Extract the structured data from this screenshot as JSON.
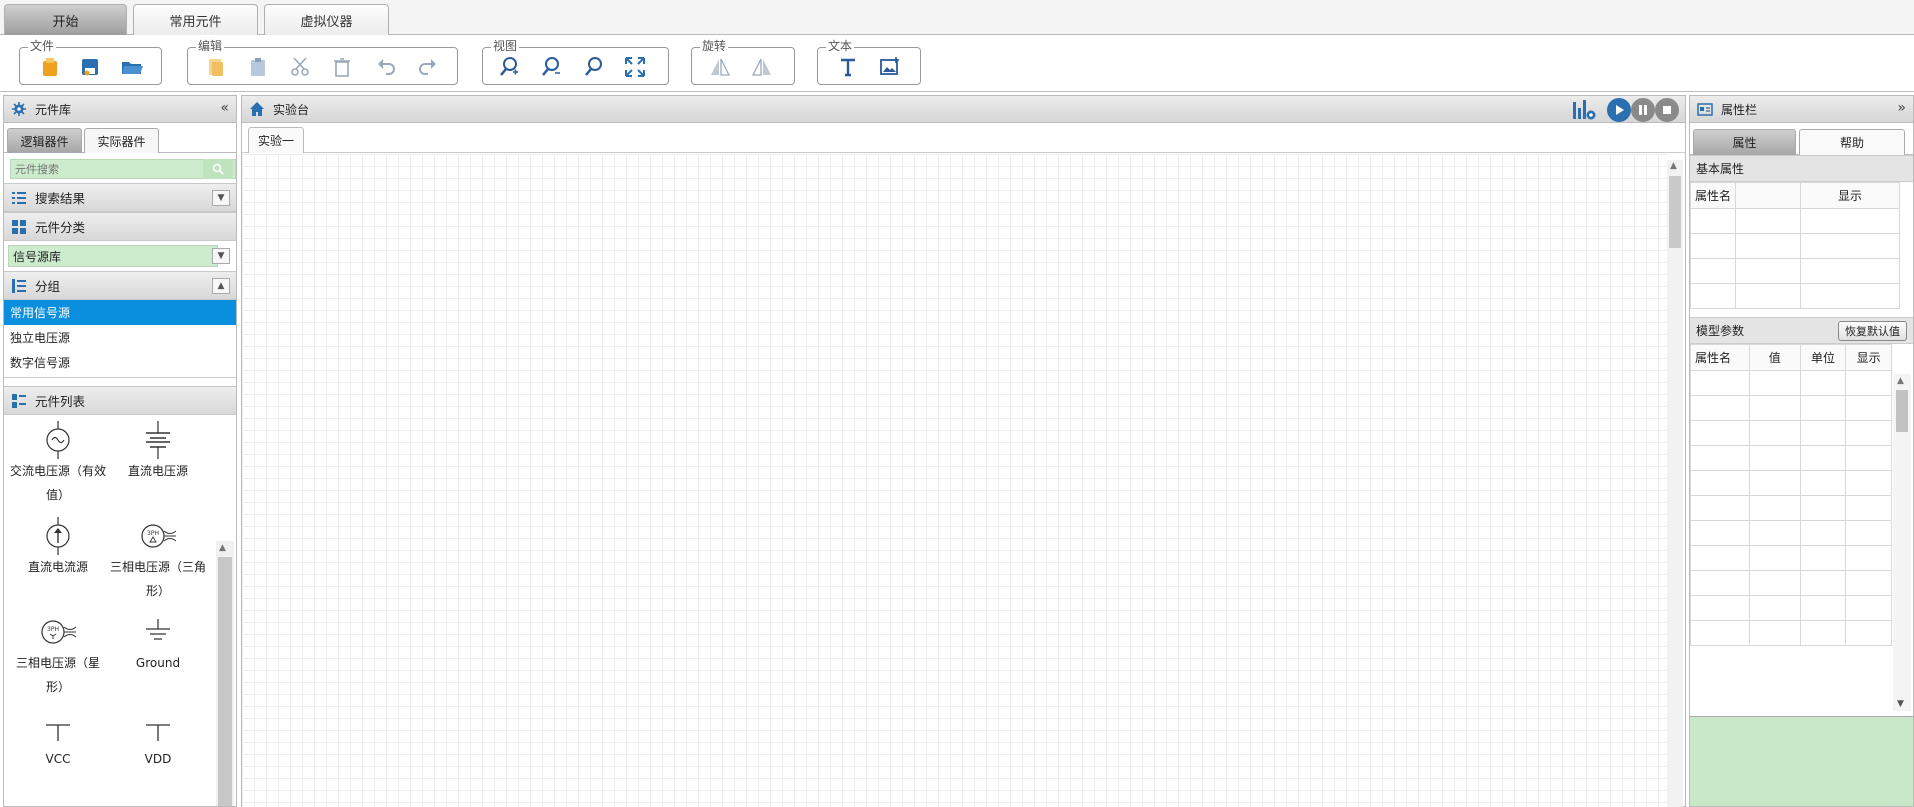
{
  "top_tabs": [
    {
      "label": "开始",
      "active": true
    },
    {
      "label": "常用元件",
      "active": false
    },
    {
      "label": "虚拟仪器",
      "active": false
    }
  ],
  "ribbon": {
    "groups": [
      {
        "label": "文件",
        "buttons": [
          "new-file-icon",
          "save-icon",
          "open-folder-icon"
        ]
      },
      {
        "label": "编辑",
        "buttons": [
          "copy-icon",
          "paste-icon",
          "cut-icon",
          "delete-icon",
          "undo-icon",
          "redo-icon"
        ]
      },
      {
        "label": "视图",
        "buttons": [
          "zoom-in-icon",
          "zoom-out-icon",
          "zoom-fit-icon",
          "fullscreen-icon"
        ]
      },
      {
        "label": "旋转",
        "buttons": [
          "flip-horizontal-icon",
          "flip-vertical-icon"
        ]
      },
      {
        "label": "文本",
        "buttons": [
          "text-icon",
          "image-icon"
        ]
      }
    ]
  },
  "left_panel": {
    "title": "元件库",
    "collapse_glyph": "«",
    "tabs": [
      {
        "label": "逻辑器件",
        "active": true
      },
      {
        "label": "实际器件",
        "active": false
      }
    ],
    "search_placeholder": "元件搜索",
    "search_results_label": "搜索结果",
    "category_label": "元件分类",
    "category_value": "信号源库",
    "group_label": "分组",
    "groups": [
      {
        "label": "常用信号源",
        "selected": true
      },
      {
        "label": "独立电压源",
        "selected": false
      },
      {
        "label": "数字信号源",
        "selected": false
      }
    ],
    "parts_label": "元件列表",
    "parts": [
      {
        "label": "交流电压源（有效值）",
        "icon": "ac-source-icon"
      },
      {
        "label": "直流电压源",
        "icon": "dc-voltage-icon"
      },
      {
        "label": "直流电流源",
        "icon": "dc-current-icon"
      },
      {
        "label": "三相电压源（三角形）",
        "icon": "three-phase-delta-icon"
      },
      {
        "label": "三相电压源（星形）",
        "icon": "three-phase-star-icon"
      },
      {
        "label": "Ground",
        "icon": "ground-icon"
      },
      {
        "label": "VCC",
        "icon": "vcc-icon"
      },
      {
        "label": "VDD",
        "icon": "vdd-icon"
      }
    ],
    "sph_text": "3PH"
  },
  "center_panel": {
    "title": "实验台",
    "tab": "实验一"
  },
  "right_panel": {
    "title": "属性栏",
    "expand_glyph": "»",
    "tabs": [
      {
        "label": "属性",
        "active": true
      },
      {
        "label": "帮助",
        "active": false
      }
    ],
    "basic_title": "基本属性",
    "basic_headers": [
      "属性名",
      "",
      "显示"
    ],
    "model_title": "模型参数",
    "restore_label": "恢复默认值",
    "model_headers": [
      "属性名",
      "值",
      "单位",
      "显示"
    ]
  },
  "colors": {
    "accent_blue": "#0a8fdf",
    "search_green": "#cdeccd",
    "icon_blue": "#2a6fb0",
    "icon_orange": "#f0a020"
  }
}
